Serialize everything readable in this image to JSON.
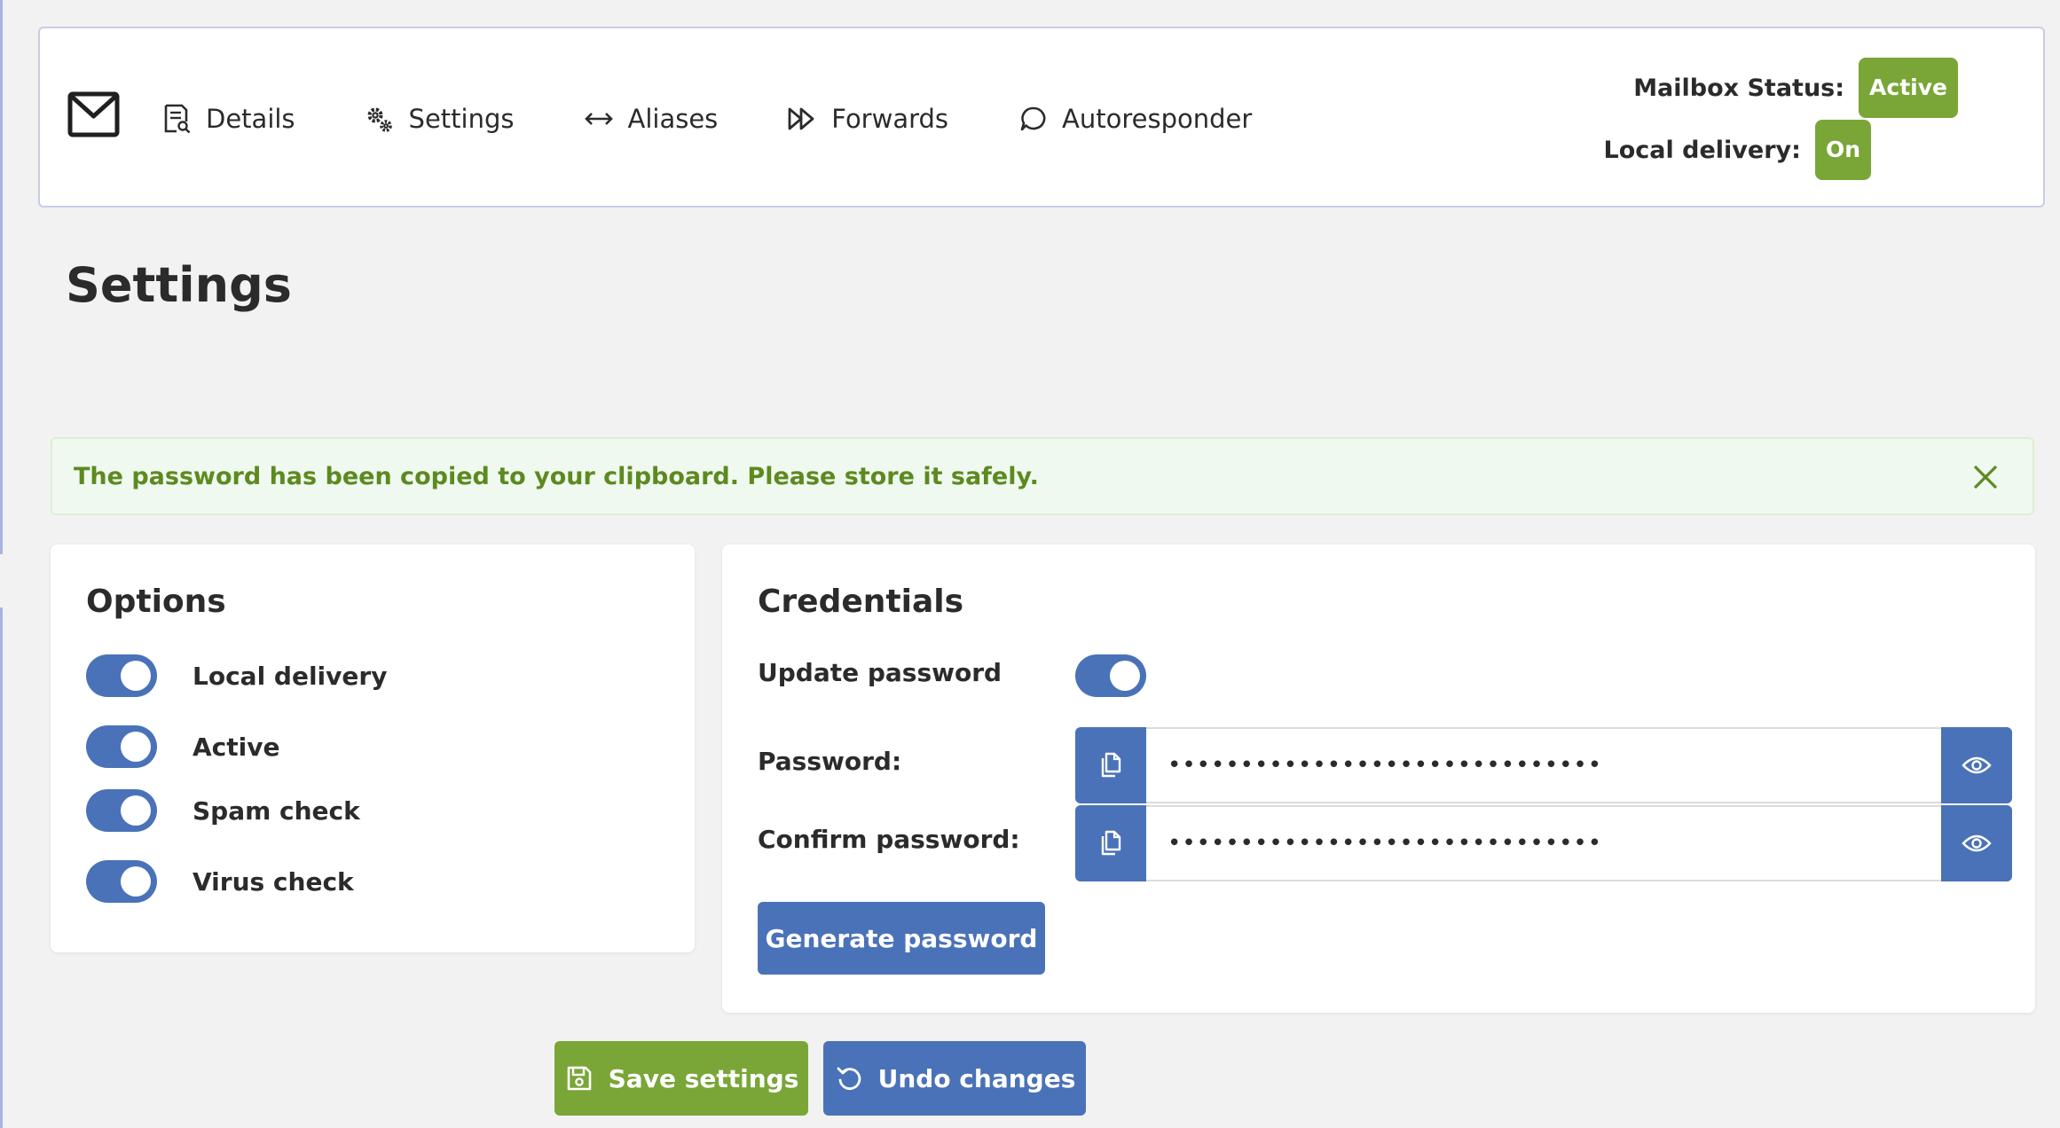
{
  "nav": {
    "items": [
      {
        "label": "Details",
        "icon": "document-search-icon"
      },
      {
        "label": "Settings",
        "icon": "gears-icon"
      },
      {
        "label": "Aliases",
        "icon": "arrows-left-right-icon"
      },
      {
        "label": "Forwards",
        "icon": "fast-forward-icon"
      },
      {
        "label": "Autoresponder",
        "icon": "speech-bubble-icon"
      }
    ]
  },
  "status": {
    "mailbox_label": "Mailbox Status:",
    "mailbox_value": "Active",
    "local_label": "Local delivery:",
    "local_value": "On"
  },
  "page": {
    "title": "Settings"
  },
  "alert": {
    "text": "The password has been copied to your clipboard. Please store it safely."
  },
  "options": {
    "title": "Options",
    "toggles": [
      {
        "label": "Local delivery",
        "on": true
      },
      {
        "label": "Active",
        "on": true
      },
      {
        "label": "Spam check",
        "on": true
      },
      {
        "label": "Virus check",
        "on": true
      }
    ]
  },
  "credentials": {
    "title": "Credentials",
    "update_label": "Update password",
    "update_on": true,
    "password_label": "Password:",
    "password_value": "••••••••••••••••••••••••••••••",
    "confirm_label": "Confirm password:",
    "confirm_value": "••••••••••••••••••••••••••••••",
    "generate_label": "Generate password"
  },
  "actions": {
    "save_label": "Save settings",
    "undo_label": "Undo changes"
  },
  "colors": {
    "accent_blue": "#4a72b8",
    "accent_green": "#79a637",
    "alert_text": "#5c8a1f"
  }
}
